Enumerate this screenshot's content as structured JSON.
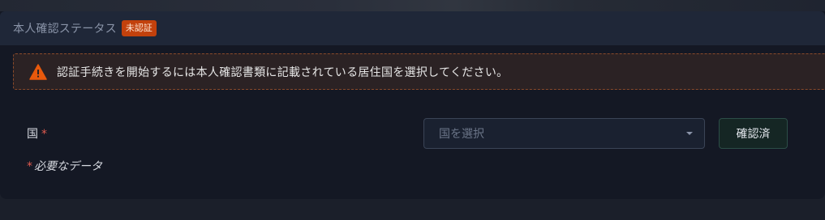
{
  "header": {
    "title": "本人確認ステータス",
    "status_badge": "未認証"
  },
  "alert": {
    "icon": "warning-icon",
    "message": "認証手続きを開始するには本人確認書類に記載されている居住国を選択してください。",
    "accent_color": "#e8590c"
  },
  "form": {
    "country_label": "国",
    "required_mark": "*",
    "country_select": {
      "placeholder": "国を選択",
      "icon": "caret-down-icon"
    },
    "confirm_button": "確認済",
    "required_note": "必要なデータ"
  }
}
